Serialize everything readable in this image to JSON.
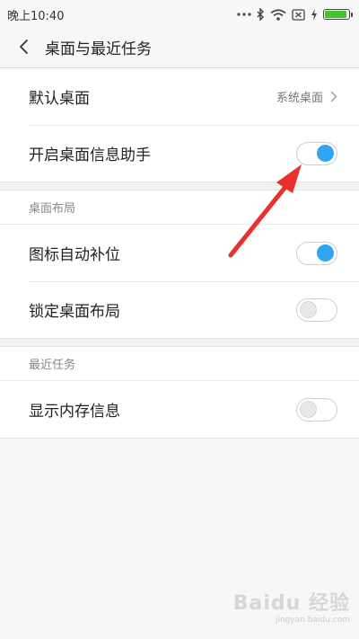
{
  "status_bar": {
    "time": "晚上10:40",
    "icons": [
      "more-dots-icon",
      "bluetooth-icon",
      "wifi-icon",
      "sim-icon",
      "charging-icon",
      "battery-icon"
    ],
    "battery_level": 0.92
  },
  "header": {
    "title": "桌面与最近任务"
  },
  "general": {
    "default_desktop_label": "默认桌面",
    "default_desktop_value": "系统桌面",
    "assistant_label": "开启桌面信息助手",
    "assistant_on": true
  },
  "layout_section": {
    "title": "桌面布局",
    "auto_fill_label": "图标自动补位",
    "auto_fill_on": true,
    "lock_label": "锁定桌面布局",
    "lock_on": false
  },
  "recent_section": {
    "title": "最近任务",
    "memory_label": "显示内存信息",
    "memory_on": false
  },
  "colors": {
    "toggle_on": "#2fa6f4",
    "annotation_arrow": "#e8312f",
    "battery": "#44c22a"
  },
  "watermark": {
    "text": "Baidu 经验",
    "sub": "jingyan.baidu.com"
  }
}
